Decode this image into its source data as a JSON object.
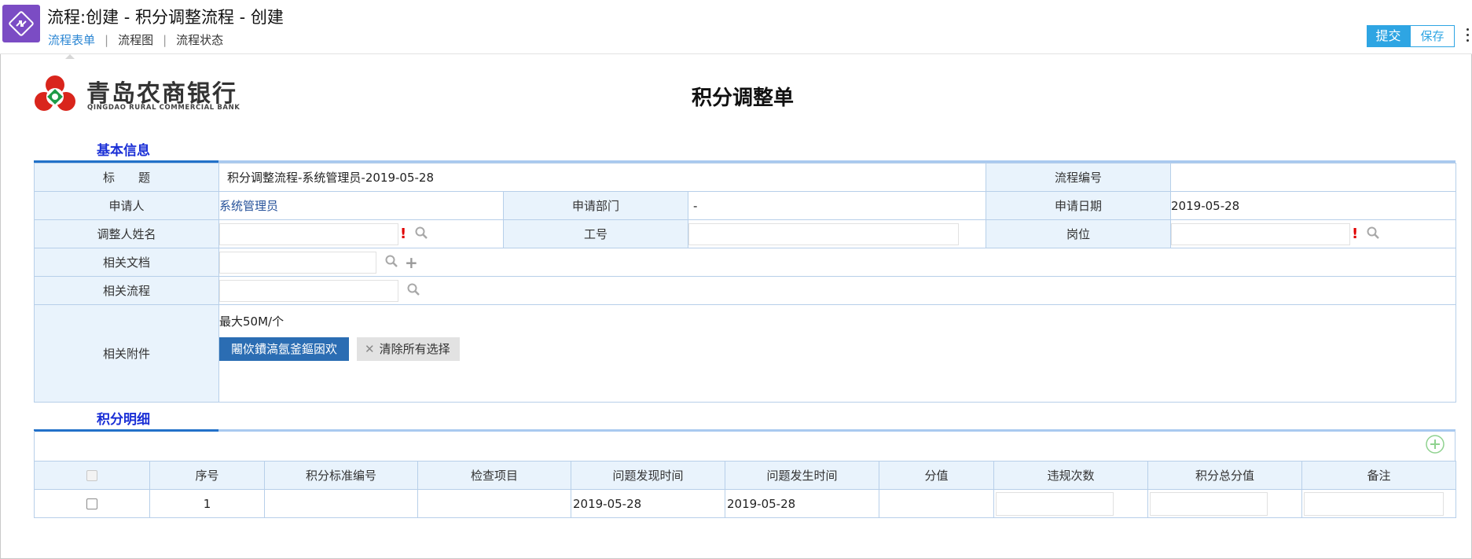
{
  "header": {
    "window_title": "流程:创建 - 积分调整流程 - 创建",
    "tabs": [
      {
        "label": "流程表单"
      },
      {
        "label": "流程图"
      },
      {
        "label": "流程状态"
      }
    ],
    "submit_label": "提交",
    "save_label": "保存"
  },
  "logo": {
    "cn": "青岛农商银行",
    "en": "QINGDAO RURAL COMMERCIAL BANK"
  },
  "form": {
    "title": "积分调整单",
    "basic_section": "基本信息",
    "labels": {
      "title": "标　　题",
      "flow_no": "流程编号",
      "applicant": "申请人",
      "dept": "申请部门",
      "apply_date": "申请日期",
      "adjust_name": "调整人姓名",
      "job_no": "工号",
      "position": "岗位",
      "related_doc": "相关文档",
      "related_flow": "相关流程",
      "attachment": "相关附件"
    },
    "values": {
      "title": "积分调整流程-系统管理员-2019-05-28",
      "flow_no": "",
      "applicant": "系统管理员",
      "dept": "-",
      "apply_date": "2019-05-28"
    },
    "attachment": {
      "hint": "最大50M/个",
      "upload_label": "闂佽鐨滈氬釜鏂囦欢",
      "clear_label": "清除所有选择"
    }
  },
  "detail": {
    "section": "积分明细",
    "columns": [
      "序号",
      "积分标准编号",
      "检查项目",
      "问题发现时间",
      "问题发生时间",
      "分值",
      "违规次数",
      "积分总分值",
      "备注"
    ],
    "rows": [
      {
        "seq": "1",
        "std_no": "",
        "check_item": "",
        "found_time": "2019-05-28",
        "occur_time": "2019-05-28",
        "score": ""
      }
    ]
  },
  "colors": {
    "accent": "#2ea5e3",
    "section_title": "#1a2fd6",
    "label_bg": "#e9f3fc",
    "border": "#b7cfe9",
    "upload_btn": "#2b6db3"
  }
}
